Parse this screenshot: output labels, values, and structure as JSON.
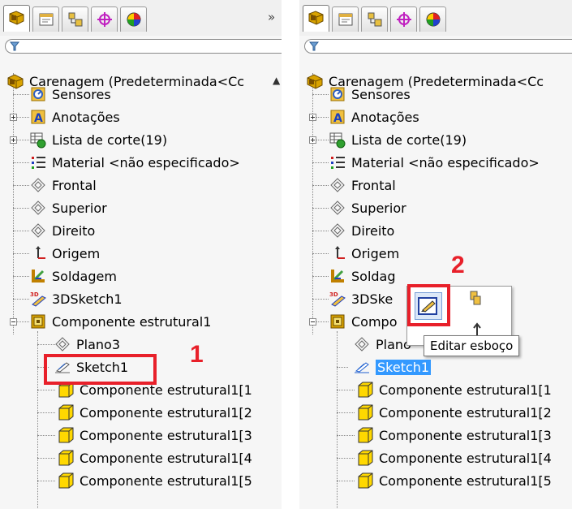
{
  "tabs": [
    {
      "name": "feature-manager",
      "icon": "feature-manager-icon"
    },
    {
      "name": "property-manager",
      "icon": "property-manager-icon"
    },
    {
      "name": "configuration-manager",
      "icon": "configuration-manager-icon"
    },
    {
      "name": "dimxpert-manager",
      "icon": "dimxpert-icon"
    },
    {
      "name": "display-manager",
      "icon": "display-manager-icon"
    }
  ],
  "more_tabs_label": "»",
  "filter_icon": "filter-icon",
  "tree": {
    "root": "Carenagem  (Predeterminada<Cc",
    "items": [
      {
        "label": "Sensores",
        "icon": "sensor-icon"
      },
      {
        "label": "Anotações",
        "icon": "annotation-icon",
        "expandable": true
      },
      {
        "label": "Lista de corte(19)",
        "icon": "cut-list-icon",
        "expandable": true
      },
      {
        "label": "Material <não especificado>",
        "icon": "material-icon"
      },
      {
        "label": "Frontal",
        "icon": "plane-icon"
      },
      {
        "label": "Superior",
        "icon": "plane-icon"
      },
      {
        "label": "Direito",
        "icon": "plane-icon"
      },
      {
        "label": "Origem",
        "icon": "origin-icon"
      },
      {
        "label": "Soldagem",
        "icon": "weldment-icon"
      },
      {
        "label": "3DSketch1",
        "icon": "3d-sketch-icon"
      },
      {
        "label": "Componente estrutural1",
        "icon": "structural-member-icon",
        "expanded": true
      },
      {
        "label": "Plano3",
        "icon": "plane-icon"
      },
      {
        "label": "Sketch1",
        "icon": "sketch-icon"
      },
      {
        "label": "Componente estrutural1[1",
        "icon": "body-icon"
      },
      {
        "label": "Componente estrutural1[2",
        "icon": "body-icon"
      },
      {
        "label": "Componente estrutural1[3",
        "icon": "body-icon"
      },
      {
        "label": "Componente estrutural1[4",
        "icon": "body-icon"
      },
      {
        "label": "Componente estrutural1[5",
        "icon": "body-icon"
      }
    ]
  },
  "right_truncated": {
    "soldagem": "Soldag",
    "sketch3d": "3DSke",
    "componente": "Compo",
    "plano": "Plano"
  },
  "annotations": {
    "step1": "1",
    "step2": "2"
  },
  "tooltip": "Editar esboço",
  "colors": {
    "highlight": "#e8202a",
    "selection": "#3399ff"
  }
}
